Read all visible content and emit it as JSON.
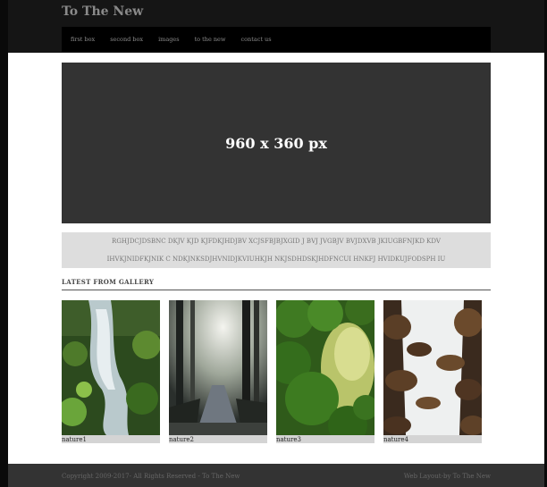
{
  "header": {
    "title": "To The New"
  },
  "nav": {
    "items": [
      "first box",
      "second box",
      "images",
      "to the new",
      "contact us"
    ]
  },
  "hero": {
    "label": "960 x 360 px"
  },
  "textbox": {
    "line1": "RGHJDCJDSBNC DKJV KJD KJFDKJHDJBV XCJSFBJBJXGID J BVJ JVGBJV BVJDXVB JKIUGBFNJKD KDV",
    "line2": "IHVKJNIDFKJNIK C NDKJNKSDJHVNIDJKVIUHKJH NKJSDHDSKJHDFNCUI HNKFJ HVIDKUJFODSPH IU"
  },
  "gallery": {
    "heading": "LATEST FROM GALLERY",
    "items": [
      {
        "caption": "nature1"
      },
      {
        "caption": "nature2"
      },
      {
        "caption": "nature3"
      },
      {
        "caption": "nature4"
      }
    ]
  },
  "footer": {
    "copyright": "Copyright 2009-2017- All Rights Reserved - To The New",
    "credit": "Web Layout-by To The New"
  }
}
